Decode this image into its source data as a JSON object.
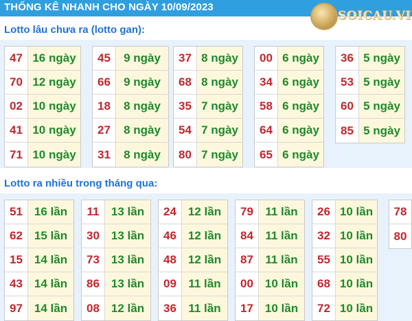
{
  "header": {
    "title": "THỐNG KÊ NHANH CHO NGÀY 10/09/2023",
    "logo_text": "SOICAU.VIP",
    "colors": {
      "bar": "#2f9fe0",
      "heading": "#1f72d6",
      "number": "#c0272d",
      "value": "#1e8a2a",
      "value_bg": "#fdf8dd",
      "band_bg": "#e8f2fc"
    }
  },
  "section_gan": {
    "heading": "Lotto lâu chưa ra (lotto gan):",
    "columns": [
      [
        {
          "num": "47",
          "val": "16 ngày"
        },
        {
          "num": "70",
          "val": "12 ngày"
        },
        {
          "num": "02",
          "val": "10 ngày"
        },
        {
          "num": "41",
          "val": "10 ngày"
        },
        {
          "num": "71",
          "val": "10 ngày"
        }
      ],
      [
        {
          "num": "45",
          "val": "9 ngày"
        },
        {
          "num": "66",
          "val": "9 ngày"
        },
        {
          "num": "18",
          "val": "8 ngày"
        },
        {
          "num": "27",
          "val": "8 ngày"
        },
        {
          "num": "31",
          "val": "8 ngày"
        }
      ],
      [
        {
          "num": "37",
          "val": "8 ngày"
        },
        {
          "num": "68",
          "val": "8 ngày"
        },
        {
          "num": "35",
          "val": "7 ngày"
        },
        {
          "num": "54",
          "val": "7 ngày"
        },
        {
          "num": "80",
          "val": "7 ngày"
        }
      ],
      [
        {
          "num": "00",
          "val": "6 ngày"
        },
        {
          "num": "34",
          "val": "6 ngày"
        },
        {
          "num": "58",
          "val": "6 ngày"
        },
        {
          "num": "64",
          "val": "6 ngày"
        },
        {
          "num": "65",
          "val": "6 ngày"
        }
      ],
      [
        {
          "num": "36",
          "val": "5 ngày"
        },
        {
          "num": "53",
          "val": "5 ngày"
        },
        {
          "num": "60",
          "val": "5 ngày"
        },
        {
          "num": "85",
          "val": "5 ngày"
        }
      ]
    ]
  },
  "section_nhieu": {
    "heading": "Lotto ra nhiều trong tháng qua:",
    "columns": [
      [
        {
          "num": "51",
          "val": "16 lần"
        },
        {
          "num": "62",
          "val": "15 lần"
        },
        {
          "num": "15",
          "val": "14 lần"
        },
        {
          "num": "43",
          "val": "14 lần"
        },
        {
          "num": "97",
          "val": "14 lần"
        }
      ],
      [
        {
          "num": "11",
          "val": "13 lần"
        },
        {
          "num": "30",
          "val": "13 lần"
        },
        {
          "num": "73",
          "val": "13 lần"
        },
        {
          "num": "86",
          "val": "13 lần"
        },
        {
          "num": "08",
          "val": "12 lần"
        }
      ],
      [
        {
          "num": "24",
          "val": "12 lần"
        },
        {
          "num": "46",
          "val": "12 lần"
        },
        {
          "num": "48",
          "val": "12 lần"
        },
        {
          "num": "09",
          "val": "11 lần"
        },
        {
          "num": "36",
          "val": "11 lần"
        }
      ],
      [
        {
          "num": "79",
          "val": "11 lần"
        },
        {
          "num": "84",
          "val": "11 lần"
        },
        {
          "num": "87",
          "val": "11 lần"
        },
        {
          "num": "00",
          "val": "10 lần"
        },
        {
          "num": "17",
          "val": "10 lần"
        }
      ],
      [
        {
          "num": "26",
          "val": "10 lần"
        },
        {
          "num": "32",
          "val": "10 lần"
        },
        {
          "num": "55",
          "val": "10 lần"
        },
        {
          "num": "68",
          "val": "10 lần"
        },
        {
          "num": "72",
          "val": "10 lần"
        }
      ],
      [
        {
          "num": "78",
          "val": ""
        },
        {
          "num": "80",
          "val": ""
        }
      ]
    ]
  }
}
